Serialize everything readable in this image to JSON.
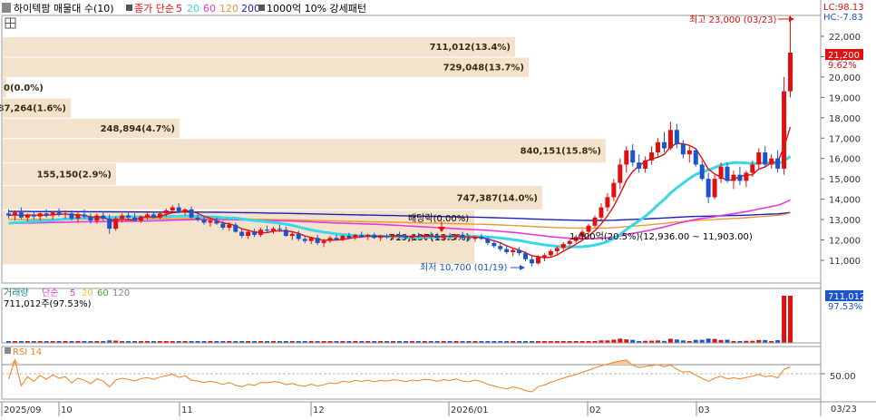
{
  "header": {
    "title": "하이텍팜 매물대 수(10)",
    "ma_prefix": "종가 단순",
    "ma_periods": [
      "5",
      "20",
      "60",
      "120",
      "200"
    ],
    "pattern_label": "1000억 10% 강세패턴"
  },
  "volume_header": {
    "label": "거래량",
    "ma_prefix": "단순",
    "ma_periods": [
      "5",
      "20",
      "60",
      "120"
    ],
    "current_volume": "711,012주(97.53%)"
  },
  "rsi_header": {
    "label": "RSI 14"
  },
  "right_labels": {
    "lc": "LC:98.13",
    "hc": "HC:-7.83",
    "price_tag": "21,200",
    "price_pct": "9.62%",
    "vol_tag": "711,012",
    "vol_pct": "97.53%",
    "rsi_level": "50.00",
    "date_tag": "03/23"
  },
  "annotations": {
    "high": "최고 23,000 (03/23)",
    "low": "최저 10,700 (01/19)",
    "dividend": "배당락(0.00%)",
    "pattern": "1,000억(20.5%)(12,936.00 ~ 11,903.00)"
  },
  "colors": {
    "up": "#e01010",
    "down": "#1a55cc",
    "ma5": "#e01010",
    "ma20": "#38d8e8",
    "ma60": "#e838d8",
    "ma120": "#e89838",
    "ma200": "#2020b8",
    "profile": "#f3e3cc",
    "rsi": "#f08020"
  },
  "chart_data": {
    "type": "candlestick",
    "y_axis_ticks": [
      "22,000",
      "21,000",
      "20,000",
      "19,000",
      "18,000",
      "17,000",
      "16,000",
      "15,000",
      "14,000",
      "13,000",
      "12,000",
      "11,000"
    ],
    "price_range": [
      10500,
      23000
    ],
    "x_axis_labels": [
      "2025/09",
      "10",
      "11",
      "12",
      "2026/01",
      "02",
      "03"
    ],
    "last_date": "03/23",
    "high": {
      "value": 23000,
      "date": "03/23"
    },
    "low": {
      "value": 10700,
      "date": "01/19"
    },
    "volume_profile": [
      {
        "label": "711,012(13.4%)",
        "price_lo": 21000,
        "price_hi": 22000
      },
      {
        "label": "729,048(13.7%)",
        "price_lo": 20000,
        "price_hi": 21000
      },
      {
        "label": "0(0.0%)",
        "price_lo": 19000,
        "price_hi": 20000
      },
      {
        "label": "87,264(1.6%)",
        "price_lo": 18000,
        "price_hi": 19000
      },
      {
        "label": "248,894(4.7%)",
        "price_lo": 17000,
        "price_hi": 18000
      },
      {
        "label": "840,151(15.8%)",
        "price_lo": 15800,
        "price_hi": 17000
      },
      {
        "label": "155,150(2.9%)",
        "price_lo": 14700,
        "price_hi": 15800
      },
      {
        "label": "747,387(14.0%)",
        "price_lo": 13500,
        "price_hi": 14700
      },
      {
        "label": "719,197(13.5%)",
        "price_lo": 10800,
        "price_hi": 13500
      }
    ],
    "candles": [
      {
        "o": 13300,
        "h": 13500,
        "l": 13050,
        "c": 13200
      },
      {
        "o": 13200,
        "h": 13450,
        "l": 12950,
        "c": 13350
      },
      {
        "o": 13350,
        "h": 13600,
        "l": 13000,
        "c": 13100
      },
      {
        "o": 13100,
        "h": 13300,
        "l": 12900,
        "c": 13250
      },
      {
        "o": 13250,
        "h": 13400,
        "l": 13000,
        "c": 13150
      },
      {
        "o": 13150,
        "h": 13350,
        "l": 12950,
        "c": 13300
      },
      {
        "o": 13300,
        "h": 13500,
        "l": 13100,
        "c": 13200
      },
      {
        "o": 13200,
        "h": 13400,
        "l": 13000,
        "c": 13350
      },
      {
        "o": 13350,
        "h": 13550,
        "l": 13150,
        "c": 13250
      },
      {
        "o": 13250,
        "h": 13450,
        "l": 13050,
        "c": 13300
      },
      {
        "o": 13300,
        "h": 13450,
        "l": 12950,
        "c": 13050
      },
      {
        "o": 13050,
        "h": 13350,
        "l": 12850,
        "c": 13250
      },
      {
        "o": 13250,
        "h": 13500,
        "l": 13050,
        "c": 13150
      },
      {
        "o": 13150,
        "h": 13300,
        "l": 12800,
        "c": 12950
      },
      {
        "o": 12950,
        "h": 13300,
        "l": 12800,
        "c": 13200
      },
      {
        "o": 13200,
        "h": 13400,
        "l": 12950,
        "c": 13050
      },
      {
        "o": 13050,
        "h": 13250,
        "l": 12300,
        "c": 12550
      },
      {
        "o": 12550,
        "h": 13150,
        "l": 12450,
        "c": 13050
      },
      {
        "o": 13050,
        "h": 13300,
        "l": 12850,
        "c": 13200
      },
      {
        "o": 13200,
        "h": 13400,
        "l": 12950,
        "c": 13100
      },
      {
        "o": 13100,
        "h": 13300,
        "l": 12900,
        "c": 12950
      },
      {
        "o": 12950,
        "h": 13200,
        "l": 12850,
        "c": 13150
      },
      {
        "o": 13150,
        "h": 13350,
        "l": 13000,
        "c": 13250
      },
      {
        "o": 13250,
        "h": 13400,
        "l": 13050,
        "c": 13100
      },
      {
        "o": 13100,
        "h": 13350,
        "l": 13000,
        "c": 13300
      },
      {
        "o": 13300,
        "h": 13550,
        "l": 13150,
        "c": 13450
      },
      {
        "o": 13450,
        "h": 13700,
        "l": 13300,
        "c": 13600
      },
      {
        "o": 13600,
        "h": 13800,
        "l": 13300,
        "c": 13350
      },
      {
        "o": 13350,
        "h": 13550,
        "l": 13200,
        "c": 13500
      },
      {
        "o": 13500,
        "h": 13650,
        "l": 13050,
        "c": 13100
      },
      {
        "o": 13100,
        "h": 13250,
        "l": 12900,
        "c": 13000
      },
      {
        "o": 13000,
        "h": 13150,
        "l": 12750,
        "c": 12850
      },
      {
        "o": 12850,
        "h": 13050,
        "l": 12650,
        "c": 12950
      },
      {
        "o": 12950,
        "h": 13100,
        "l": 12750,
        "c": 12800
      },
      {
        "o": 12800,
        "h": 12950,
        "l": 12500,
        "c": 12600
      },
      {
        "o": 12600,
        "h": 12850,
        "l": 12450,
        "c": 12750
      },
      {
        "o": 12750,
        "h": 12850,
        "l": 12350,
        "c": 12400
      },
      {
        "o": 12400,
        "h": 12550,
        "l": 12100,
        "c": 12200
      },
      {
        "o": 12200,
        "h": 12500,
        "l": 12050,
        "c": 12400
      },
      {
        "o": 12400,
        "h": 12550,
        "l": 12150,
        "c": 12250
      },
      {
        "o": 12250,
        "h": 12600,
        "l": 12150,
        "c": 12500
      },
      {
        "o": 12500,
        "h": 12700,
        "l": 12350,
        "c": 12450
      },
      {
        "o": 12450,
        "h": 12650,
        "l": 12300,
        "c": 12550
      },
      {
        "o": 12550,
        "h": 12750,
        "l": 12400,
        "c": 12500
      },
      {
        "o": 12500,
        "h": 12650,
        "l": 12150,
        "c": 12200
      },
      {
        "o": 12200,
        "h": 12400,
        "l": 12000,
        "c": 12300
      },
      {
        "o": 12300,
        "h": 12450,
        "l": 11950,
        "c": 12050
      },
      {
        "o": 12050,
        "h": 12200,
        "l": 11850,
        "c": 11950
      },
      {
        "o": 11950,
        "h": 12150,
        "l": 11800,
        "c": 12100
      },
      {
        "o": 12100,
        "h": 12250,
        "l": 11750,
        "c": 11850
      },
      {
        "o": 11850,
        "h": 12050,
        "l": 11650,
        "c": 11950
      },
      {
        "o": 11950,
        "h": 12200,
        "l": 11850,
        "c": 12100
      },
      {
        "o": 12100,
        "h": 12250,
        "l": 11950,
        "c": 12000
      },
      {
        "o": 12000,
        "h": 12250,
        "l": 11950,
        "c": 12200
      },
      {
        "o": 12200,
        "h": 12350,
        "l": 12050,
        "c": 12100
      },
      {
        "o": 12100,
        "h": 12300,
        "l": 12000,
        "c": 12250
      },
      {
        "o": 12250,
        "h": 12400,
        "l": 12100,
        "c": 12150
      },
      {
        "o": 12150,
        "h": 12300,
        "l": 12000,
        "c": 12250
      },
      {
        "o": 12250,
        "h": 12350,
        "l": 12050,
        "c": 12100
      },
      {
        "o": 12100,
        "h": 12250,
        "l": 11950,
        "c": 12200
      },
      {
        "o": 12200,
        "h": 12300,
        "l": 12050,
        "c": 12150
      },
      {
        "o": 12150,
        "h": 12300,
        "l": 12000,
        "c": 12250
      },
      {
        "o": 12250,
        "h": 12400,
        "l": 12100,
        "c": 12200
      },
      {
        "o": 12200,
        "h": 12300,
        "l": 12050,
        "c": 12100
      },
      {
        "o": 12100,
        "h": 12250,
        "l": 11950,
        "c": 12200
      },
      {
        "o": 12200,
        "h": 12350,
        "l": 12100,
        "c": 12150
      },
      {
        "o": 12150,
        "h": 12300,
        "l": 12000,
        "c": 12250
      },
      {
        "o": 12250,
        "h": 12400,
        "l": 12100,
        "c": 12200
      },
      {
        "o": 12200,
        "h": 12350,
        "l": 12050,
        "c": 12100
      },
      {
        "o": 12100,
        "h": 12250,
        "l": 11950,
        "c": 12200
      },
      {
        "o": 12200,
        "h": 12350,
        "l": 12050,
        "c": 12150
      },
      {
        "o": 12150,
        "h": 12300,
        "l": 12000,
        "c": 12250
      },
      {
        "o": 12250,
        "h": 12400,
        "l": 12050,
        "c": 12100
      },
      {
        "o": 12100,
        "h": 12250,
        "l": 11950,
        "c": 12050
      },
      {
        "o": 12050,
        "h": 12200,
        "l": 11900,
        "c": 12150
      },
      {
        "o": 12150,
        "h": 12300,
        "l": 12000,
        "c": 12050
      },
      {
        "o": 12050,
        "h": 12150,
        "l": 11750,
        "c": 11850
      },
      {
        "o": 11850,
        "h": 12000,
        "l": 11600,
        "c": 11700
      },
      {
        "o": 11700,
        "h": 11900,
        "l": 11450,
        "c": 11550
      },
      {
        "o": 11550,
        "h": 11750,
        "l": 11300,
        "c": 11400
      },
      {
        "o": 11400,
        "h": 11600,
        "l": 11200,
        "c": 11500
      },
      {
        "o": 11500,
        "h": 11650,
        "l": 11250,
        "c": 11350
      },
      {
        "o": 11350,
        "h": 11450,
        "l": 10950,
        "c": 11050
      },
      {
        "o": 11050,
        "h": 11200,
        "l": 10700,
        "c": 10850
      },
      {
        "o": 10850,
        "h": 11250,
        "l": 10800,
        "c": 11150
      },
      {
        "o": 11150,
        "h": 11350,
        "l": 10950,
        "c": 11250
      },
      {
        "o": 11250,
        "h": 11550,
        "l": 11150,
        "c": 11450
      },
      {
        "o": 11450,
        "h": 11700,
        "l": 11300,
        "c": 11600
      },
      {
        "o": 11600,
        "h": 11900,
        "l": 11500,
        "c": 11800
      },
      {
        "o": 11800,
        "h": 12050,
        "l": 11700,
        "c": 11950
      },
      {
        "o": 11950,
        "h": 12250,
        "l": 11850,
        "c": 12150
      },
      {
        "o": 12150,
        "h": 12500,
        "l": 12050,
        "c": 12400
      },
      {
        "o": 12400,
        "h": 12800,
        "l": 12300,
        "c": 12700
      },
      {
        "o": 12700,
        "h": 13200,
        "l": 12600,
        "c": 13100
      },
      {
        "o": 13100,
        "h": 13800,
        "l": 12900,
        "c": 13600
      },
      {
        "o": 13600,
        "h": 14300,
        "l": 13400,
        "c": 14100
      },
      {
        "o": 14100,
        "h": 15000,
        "l": 13900,
        "c": 14800
      },
      {
        "o": 14800,
        "h": 16000,
        "l": 14500,
        "c": 15700
      },
      {
        "o": 15700,
        "h": 16600,
        "l": 15300,
        "c": 16400
      },
      {
        "o": 16400,
        "h": 16700,
        "l": 15600,
        "c": 15800
      },
      {
        "o": 15800,
        "h": 16200,
        "l": 15300,
        "c": 15500
      },
      {
        "o": 15500,
        "h": 16100,
        "l": 15300,
        "c": 15900
      },
      {
        "o": 15900,
        "h": 16600,
        "l": 15700,
        "c": 16300
      },
      {
        "o": 16300,
        "h": 17000,
        "l": 16100,
        "c": 16800
      },
      {
        "o": 16800,
        "h": 17300,
        "l": 16300,
        "c": 16500
      },
      {
        "o": 16500,
        "h": 17800,
        "l": 16400,
        "c": 17400
      },
      {
        "o": 17400,
        "h": 17700,
        "l": 16500,
        "c": 16700
      },
      {
        "o": 16700,
        "h": 16900,
        "l": 16000,
        "c": 16200
      },
      {
        "o": 16200,
        "h": 16600,
        "l": 15800,
        "c": 16400
      },
      {
        "o": 16400,
        "h": 16500,
        "l": 15600,
        "c": 15700
      },
      {
        "o": 15700,
        "h": 15900,
        "l": 14900,
        "c": 15000
      },
      {
        "o": 15000,
        "h": 15300,
        "l": 13800,
        "c": 14100
      },
      {
        "o": 14100,
        "h": 15200,
        "l": 14000,
        "c": 15000
      },
      {
        "o": 15000,
        "h": 15800,
        "l": 14800,
        "c": 15600
      },
      {
        "o": 15600,
        "h": 15800,
        "l": 14800,
        "c": 14900
      },
      {
        "o": 14900,
        "h": 15400,
        "l": 14500,
        "c": 15200
      },
      {
        "o": 15200,
        "h": 15600,
        "l": 14700,
        "c": 14900
      },
      {
        "o": 14900,
        "h": 15400,
        "l": 14600,
        "c": 15300
      },
      {
        "o": 15300,
        "h": 15900,
        "l": 15100,
        "c": 15700
      },
      {
        "o": 15700,
        "h": 16500,
        "l": 15500,
        "c": 16300
      },
      {
        "o": 16300,
        "h": 16600,
        "l": 15600,
        "c": 15700
      },
      {
        "o": 15700,
        "h": 16200,
        "l": 15500,
        "c": 16000
      },
      {
        "o": 16000,
        "h": 16400,
        "l": 15300,
        "c": 15500
      },
      {
        "o": 15500,
        "h": 20000,
        "l": 15200,
        "c": 19300
      },
      {
        "o": 19300,
        "h": 23000,
        "l": 19000,
        "c": 21200
      }
    ],
    "volume_max": 711012,
    "rsi_levels": [
      "50.00"
    ]
  }
}
